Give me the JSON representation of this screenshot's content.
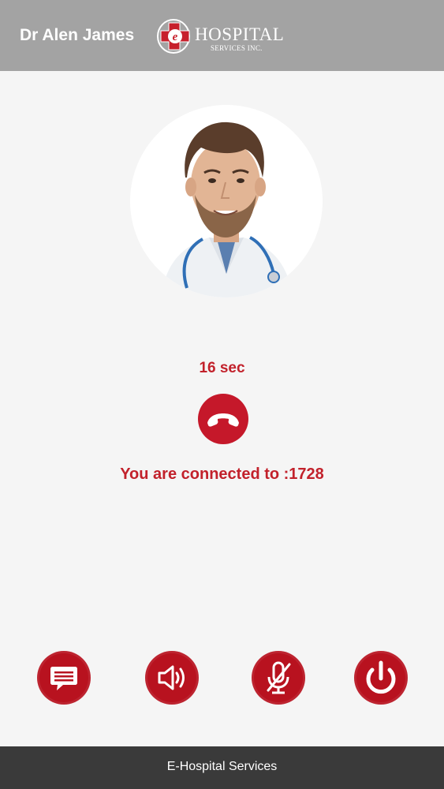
{
  "header": {
    "doctor_name": "Dr Alen James",
    "logo": {
      "mark_letter": "e",
      "main_text": "HOSPITAL",
      "sub_text": "SERVICES INC."
    }
  },
  "call": {
    "duration": "16 sec",
    "status": "You are connected to :1728",
    "hangup_icon": "phone-hangup-icon"
  },
  "actions": [
    {
      "id": "chat",
      "icon": "chat-icon"
    },
    {
      "id": "speaker",
      "icon": "speaker-icon"
    },
    {
      "id": "mute",
      "icon": "mic-muted-icon"
    },
    {
      "id": "end",
      "icon": "power-icon"
    }
  ],
  "footer": {
    "text": "E-Hospital Services"
  },
  "colors": {
    "header_bg": "#a3a3a3",
    "accent_red": "#c2212b",
    "button_red": "#b8121f",
    "footer_bg": "#3a3a3a",
    "page_bg": "#f5f5f5"
  }
}
